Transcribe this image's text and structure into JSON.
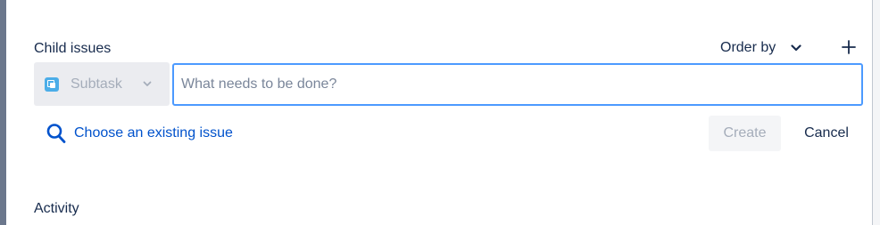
{
  "child_issues": {
    "title": "Child issues",
    "order_by_label": "Order by",
    "issue_type": "Subtask",
    "summary_placeholder": "What needs to be done?",
    "summary_value": "",
    "choose_existing_label": "Choose an existing issue",
    "create_label": "Create",
    "cancel_label": "Cancel"
  },
  "activity": {
    "title": "Activity"
  },
  "colors": {
    "link": "#0052cc",
    "focus_border": "#4c9aff",
    "subtask_icon": "#4bade8",
    "disabled_text": "#a5adba"
  },
  "icons": {
    "order_by": "chevron-down-icon",
    "add": "plus-icon",
    "issue_type": "subtask-icon",
    "type_select": "chevron-down-icon",
    "choose_existing": "search-icon"
  }
}
